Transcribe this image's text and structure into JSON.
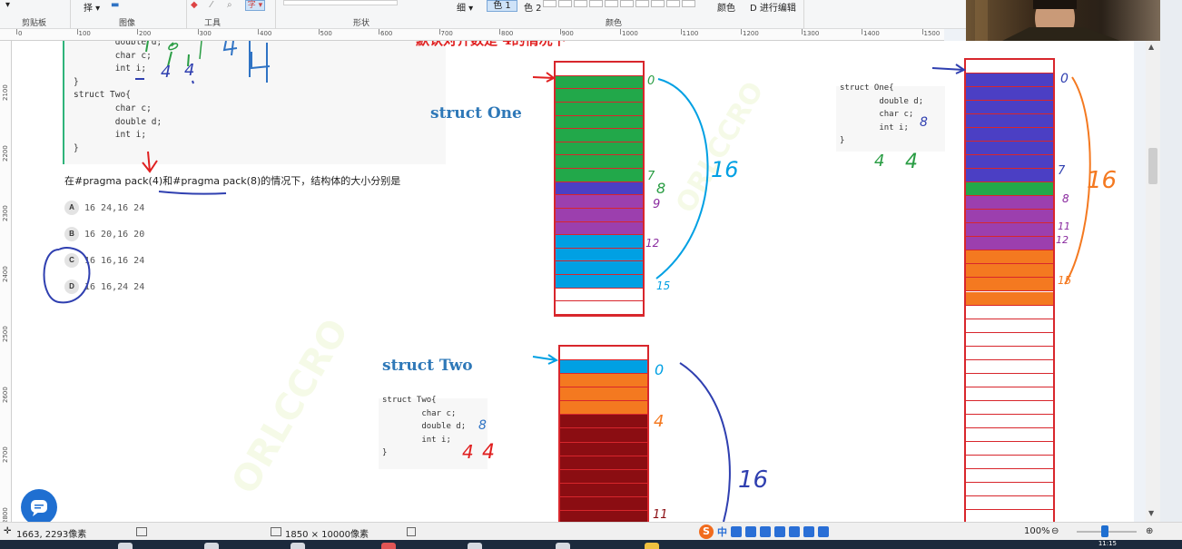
{
  "ribbon": {
    "clipboard_label": "剪贴板",
    "image_label": "图像",
    "tools_label": "工具",
    "shapes_label": "形状",
    "colors_label": "颜色",
    "select_button": "择",
    "text_button": "字",
    "thickness_label": "细",
    "color1_label": "色 1",
    "color2_label": "色 2",
    "edit_colors_label": "颜色",
    "edit_3d_label": "D 进行编辑"
  },
  "ruler": {
    "h_ticks": [
      "0",
      "100",
      "200",
      "300",
      "400",
      "500",
      "600",
      "700",
      "800",
      "900",
      "1000",
      "1100",
      "1200",
      "1300",
      "1400",
      "1500"
    ],
    "v_ticks": [
      "2100",
      "2200",
      "2300",
      "2400",
      "2500",
      "2600",
      "2700",
      "2800"
    ]
  },
  "doc": {
    "code_top": "        double d;\n        char c;\n        int i;\n}\nstruct Two{\n        char c;\n        double d;\n        int i;\n}",
    "question": "在#pragma pack(4)和#pragma pack(8)的情况下，结构体的大小分别是",
    "options": [
      {
        "badge": "A",
        "text": "16 24,16 24"
      },
      {
        "badge": "B",
        "text": "16 20,16 20"
      },
      {
        "badge": "C",
        "text": "16 16,16 24"
      },
      {
        "badge": "D",
        "text": "16 16,24 24"
      }
    ],
    "struct_one_title": "struct One",
    "struct_two_title": "struct Two",
    "heading_partial": "默认对齐数是 4的情况下",
    "code_struct_two": "struct Two{\n        char c;\n        double d;\n        int i;\n}",
    "code_struct_one": "struct One{\n        double d;\n        char c;\n        int i;\n}",
    "watermark": "ORLCCRO"
  },
  "annotations": {
    "one_0": "0",
    "one_7": "7",
    "one_8": "8",
    "one_9": "9",
    "one_12": "12",
    "one_15": "15",
    "one_16": "16",
    "two_0": "0",
    "two_4": "4",
    "two_11": "11",
    "two_16": "16",
    "r_0": "0",
    "r_7": "7",
    "r_8": "8",
    "r_11": "11",
    "r_12": "12",
    "r_15": "15",
    "r_16": "16",
    "hw_144": "4",
    "hw_one_4": "4",
    "hw_one_8": "8",
    "hw_two_8": "8",
    "hw_two_4": "4"
  },
  "status": {
    "cursor_pos": "1663, 2293像素",
    "canvas_size": "1850 × 10000像素",
    "zoom": "100%",
    "clock": "11:15"
  },
  "ime": {
    "brand": "S",
    "mode": "中"
  },
  "colors": {
    "green": "#22a84a",
    "blue_purple": "#4b3fc4",
    "purple": "#9c3fae",
    "cyan": "#00a0e3",
    "orange": "#f47920",
    "darkred": "#8b0d12",
    "red_border": "#d8262c"
  }
}
